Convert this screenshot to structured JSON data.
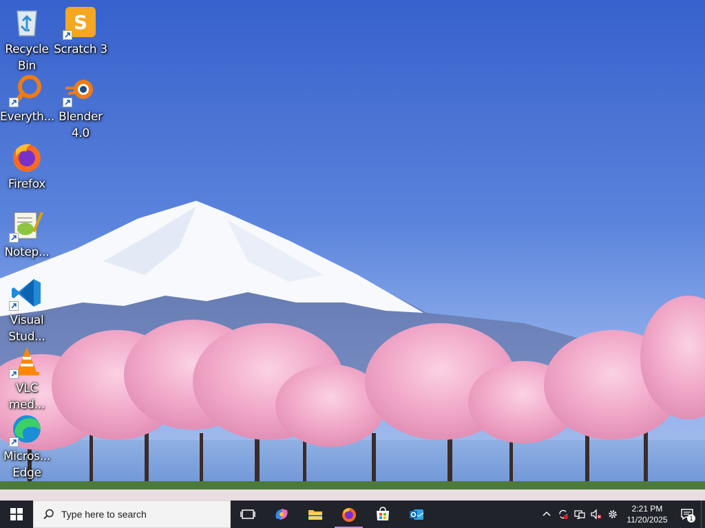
{
  "desktop": {
    "icons": [
      {
        "label": "Recycle Bin",
        "icon": "recycle-bin-icon",
        "shortcut": false
      },
      {
        "label": "Scratch 3",
        "icon": "scratch-icon",
        "shortcut": true
      },
      {
        "label": "Everyth...",
        "icon": "everything-search-icon",
        "shortcut": true
      },
      {
        "label": "Blender 4.0",
        "icon": "blender-icon",
        "shortcut": true
      },
      {
        "label": "Firefox",
        "icon": "firefox-icon",
        "shortcut": false
      },
      {
        "label": "Notep...",
        "icon": "notepad-plus-plus-icon",
        "shortcut": true
      },
      {
        "label": "Visual Stud...",
        "icon": "vscode-icon",
        "shortcut": true
      },
      {
        "label": "VLC med...",
        "icon": "vlc-icon",
        "shortcut": true
      },
      {
        "label": "Micros... Edge",
        "icon": "edge-icon",
        "shortcut": true
      }
    ]
  },
  "taskbar": {
    "search_placeholder": "Type here to search",
    "pinned": [
      {
        "name": "task-view",
        "icon": "task-view-icon"
      },
      {
        "name": "copilot",
        "icon": "copilot-icon"
      },
      {
        "name": "file-explorer",
        "icon": "folder-icon"
      },
      {
        "name": "firefox",
        "icon": "firefox-icon",
        "active": true
      },
      {
        "name": "microsoft-store",
        "icon": "store-icon"
      },
      {
        "name": "outlook",
        "icon": "outlook-icon"
      }
    ],
    "clock": {
      "time": "2:21 PM",
      "date": "11/20/2025"
    },
    "notification_count": "1"
  },
  "colors": {
    "taskbar_bg": "#20232a",
    "search_bg": "#f3f3f3",
    "sky_top": "#3a63cf",
    "blossom": "#f4a9c9"
  }
}
